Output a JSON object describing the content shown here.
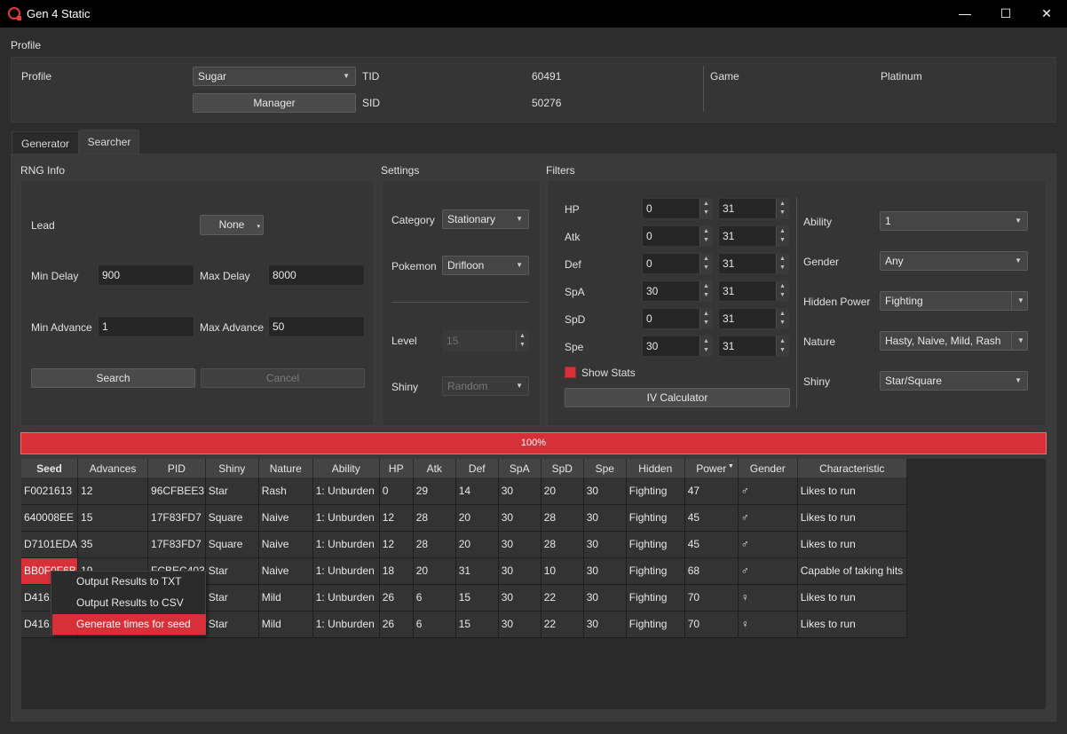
{
  "window": {
    "title": "Gen 4 Static",
    "min": "—",
    "max": "☐",
    "close": "✕"
  },
  "profile": {
    "group_title": "Profile",
    "profile_label": "Profile",
    "profile_value": "Sugar",
    "manager_button": "Manager",
    "tid_label": "TID",
    "tid_value": "60491",
    "sid_label": "SID",
    "sid_value": "50276",
    "game_label": "Game",
    "game_value": "Platinum"
  },
  "tabs": [
    {
      "label": "Generator"
    },
    {
      "label": "Searcher"
    }
  ],
  "rng_info": {
    "title": "RNG Info",
    "lead_label": "Lead",
    "lead_value": "None",
    "min_delay_label": "Min Delay",
    "min_delay_value": "900",
    "max_delay_label": "Max Delay",
    "max_delay_value": "8000",
    "min_adv_label": "Min Advance",
    "min_adv_value": "1",
    "max_adv_label": "Max Advance",
    "max_adv_value": "50",
    "search_button": "Search",
    "cancel_button": "Cancel"
  },
  "settings": {
    "title": "Settings",
    "category_label": "Category",
    "category_value": "Stationary",
    "pokemon_label": "Pokemon",
    "pokemon_value": "Drifloon",
    "level_label": "Level",
    "level_value": "15",
    "shiny_label": "Shiny",
    "shiny_value": "Random"
  },
  "filters": {
    "title": "Filters",
    "ivs": [
      {
        "label": "HP",
        "min": "0",
        "max": "31"
      },
      {
        "label": "Atk",
        "min": "0",
        "max": "31"
      },
      {
        "label": "Def",
        "min": "0",
        "max": "31"
      },
      {
        "label": "SpA",
        "min": "30",
        "max": "31"
      },
      {
        "label": "SpD",
        "min": "0",
        "max": "31"
      },
      {
        "label": "Spe",
        "min": "30",
        "max": "31"
      }
    ],
    "show_stats_label": "Show Stats",
    "iv_calc_button": "IV Calculator",
    "ability_label": "Ability",
    "ability_value": "1",
    "gender_label": "Gender",
    "gender_value": "Any",
    "hidden_power_label": "Hidden Power",
    "hidden_power_value": "Fighting",
    "nature_label": "Nature",
    "nature_value": "Hasty, Naive, Mild, Rash",
    "shiny_label": "Shiny",
    "shiny_value": "Star/Square"
  },
  "progress": {
    "text": "100%",
    "value": 100
  },
  "table": {
    "columns": [
      "Seed",
      "Advances",
      "PID",
      "Shiny",
      "Nature",
      "Ability",
      "HP",
      "Atk",
      "Def",
      "SpA",
      "SpD",
      "Spe",
      "Hidden",
      "Power",
      "Gender",
      "Characteristic"
    ],
    "rows": [
      [
        "F0021613",
        "12",
        "96CFBEE3",
        "Star",
        "Rash",
        "1: Unburden",
        "0",
        "29",
        "14",
        "30",
        "20",
        "30",
        "Fighting",
        "47",
        "♂",
        "Likes to run"
      ],
      [
        "640008EE",
        "15",
        "17F83FD7",
        "Square",
        "Naive",
        "1: Unburden",
        "12",
        "28",
        "20",
        "30",
        "28",
        "30",
        "Fighting",
        "45",
        "♂",
        "Likes to run"
      ],
      [
        "D7101EDA",
        "35",
        "17F83FD7",
        "Square",
        "Naive",
        "1: Unburden",
        "12",
        "28",
        "20",
        "30",
        "28",
        "30",
        "Fighting",
        "45",
        "♂",
        "Likes to run"
      ],
      [
        "BB0F0F6B",
        "19",
        "FCBEC403",
        "Star",
        "Naive",
        "1: Unburden",
        "18",
        "20",
        "31",
        "30",
        "10",
        "30",
        "Fighting",
        "68",
        "♂",
        "Capable of taking hits"
      ],
      [
        "D4161",
        "",
        "",
        "Star",
        "Mild",
        "1: Unburden",
        "26",
        "6",
        "15",
        "30",
        "22",
        "30",
        "Fighting",
        "70",
        "♀",
        "Likes to run"
      ],
      [
        "D4161",
        "",
        "",
        "Star",
        "Mild",
        "1: Unburden",
        "26",
        "6",
        "15",
        "30",
        "22",
        "30",
        "Fighting",
        "70",
        "♀",
        "Likes to run"
      ]
    ]
  },
  "context_menu": {
    "items": [
      {
        "label": "Output Results to TXT"
      },
      {
        "label": "Output Results to CSV"
      },
      {
        "label": "Generate times for seed"
      }
    ]
  },
  "colors": {
    "accent": "#d73039",
    "bg": "#2d2d2d",
    "titlebar": "#000000"
  }
}
